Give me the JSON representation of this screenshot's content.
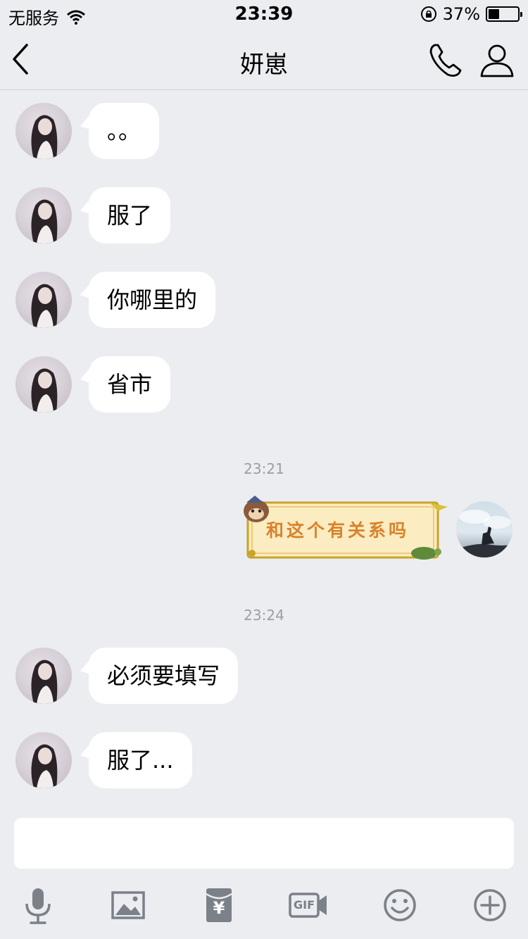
{
  "status_bar": {
    "carrier": "无服务",
    "time": "23:39",
    "battery_percent": "37%",
    "battery_level": 0.37,
    "icons": [
      "wifi-icon",
      "orientation-lock-icon",
      "battery-icon"
    ]
  },
  "nav": {
    "title": "妍崽",
    "icons": [
      "back-chevron-icon",
      "phone-icon",
      "user-icon"
    ]
  },
  "messages": [
    {
      "side": "left",
      "text": "。。"
    },
    {
      "side": "left",
      "text": "服了"
    },
    {
      "side": "left",
      "text": "你哪里的"
    },
    {
      "side": "left",
      "text": "省市"
    },
    {
      "type": "timestamp",
      "text": "23:21"
    },
    {
      "side": "right",
      "type": "sticker",
      "text": "和这个有关系吗"
    },
    {
      "type": "timestamp",
      "text": "23:24"
    },
    {
      "side": "left",
      "text": "必须要填写"
    },
    {
      "side": "left",
      "text": "服了..."
    }
  ],
  "input": {
    "value": ""
  },
  "toolbar": {
    "icons": [
      "microphone-icon",
      "image-icon",
      "red-packet-icon",
      "gif-icon",
      "emoji-icon",
      "plus-icon"
    ],
    "gif_label": "GIF",
    "red_packet_label": "¥"
  },
  "colors": {
    "background": "#ebedf0",
    "bubble": "#ffffff",
    "icon_gray": "#7b8089",
    "sticker_text": "#d9822b"
  }
}
